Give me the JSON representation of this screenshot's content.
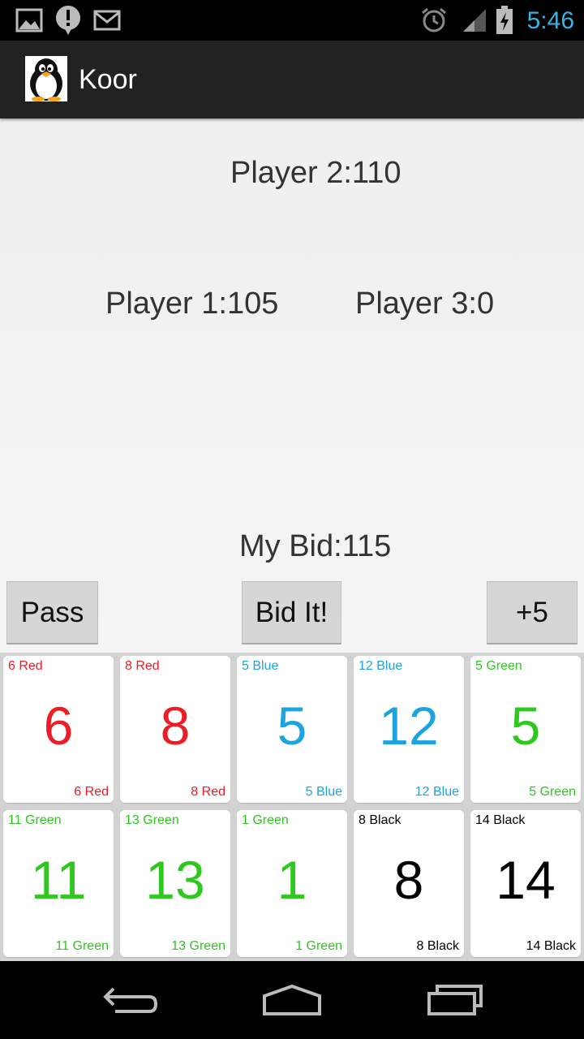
{
  "status_bar": {
    "time": "5:46",
    "icons": [
      "gallery-icon",
      "alert-icon",
      "gmail-icon",
      "alarm-icon",
      "signal-icon",
      "battery-charging-icon"
    ],
    "accent_color": "#33b5e5"
  },
  "action_bar": {
    "title": "Koor",
    "app_icon": "penguin-icon"
  },
  "players": {
    "player2": "Player 2:110",
    "player1": "Player 1:105",
    "player3": "Player 3:0"
  },
  "my_bid": "My Bid:115",
  "buttons": {
    "pass": "Pass",
    "bid_it": "Bid It!",
    "plus5": "+5"
  },
  "cards": [
    {
      "number": "6",
      "label": "6 Red",
      "color": "red"
    },
    {
      "number": "8",
      "label": "8 Red",
      "color": "red"
    },
    {
      "number": "5",
      "label": "5 Blue",
      "color": "blue"
    },
    {
      "number": "12",
      "label": "12 Blue",
      "color": "blue"
    },
    {
      "number": "5",
      "label": "5 Green",
      "color": "green"
    },
    {
      "number": "11",
      "label": "11 Green",
      "color": "green"
    },
    {
      "number": "13",
      "label": "13 Green",
      "color": "green"
    },
    {
      "number": "1",
      "label": "1 Green",
      "color": "green"
    },
    {
      "number": "8",
      "label": "8 Black",
      "color": "black"
    },
    {
      "number": "14",
      "label": "14 Black",
      "color": "black"
    }
  ],
  "colors": {
    "red": "#ee1c25",
    "blue": "#1da3e0",
    "green": "#2ec81e",
    "black": "#000000"
  },
  "nav_bar": {
    "icons": [
      "back-icon",
      "home-icon",
      "recent-apps-icon"
    ]
  }
}
